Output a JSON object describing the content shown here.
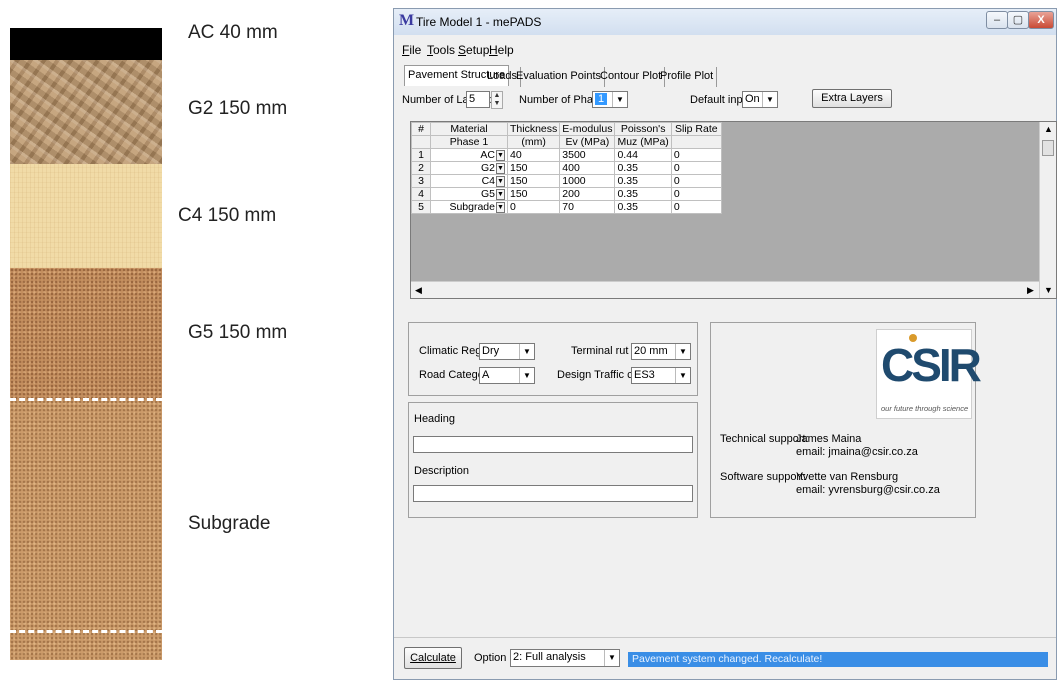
{
  "figure": {
    "layers": [
      {
        "label": "AC 40 mm"
      },
      {
        "label": "G2 150 mm"
      },
      {
        "label": "C4 150 mm"
      },
      {
        "label": "G5 150 mm"
      },
      {
        "label": "Subgrade"
      }
    ]
  },
  "window": {
    "app_icon": "M",
    "title": "Tire Model 1 - mePADS",
    "controls": {
      "minimize": "–",
      "maximize": "▢",
      "close": "X"
    }
  },
  "menu": [
    {
      "key": "F",
      "rest": "ile"
    },
    {
      "key": "T",
      "rest": "ools"
    },
    {
      "key": "S",
      "rest": "etup"
    },
    {
      "key": "H",
      "rest": "elp"
    }
  ],
  "tabs": [
    "Pavement Structure",
    "Loads",
    "Evaluation Points",
    "Contour Plot",
    "Profile Plot"
  ],
  "controls_row": {
    "layers_label": "Number of Layers:",
    "layers_value": "5",
    "phases_label": "Number of Phases:",
    "phases_value": "1",
    "default_label": "Default input:",
    "default_value": "On",
    "extra_layers_button": "Extra Layers"
  },
  "grid": {
    "headers_row1": [
      "#",
      "Material",
      "Thickness",
      "E-modulus",
      "Poisson's",
      "Slip Rate"
    ],
    "headers_row2": [
      "",
      "Phase 1",
      "(mm)",
      "Ev (MPa)",
      "Muz (MPa)",
      ""
    ],
    "rows": [
      {
        "n": "1",
        "material": "AC",
        "thickness": "40",
        "emod": "3500",
        "poisson": "0.44",
        "slip": "0"
      },
      {
        "n": "2",
        "material": "G2",
        "thickness": "150",
        "emod": "400",
        "poisson": "0.35",
        "slip": "0"
      },
      {
        "n": "3",
        "material": "C4",
        "thickness": "150",
        "emod": "1000",
        "poisson": "0.35",
        "slip": "0"
      },
      {
        "n": "4",
        "material": "G5",
        "thickness": "150",
        "emod": "200",
        "poisson": "0.35",
        "slip": "0"
      },
      {
        "n": "5",
        "material": "Subgrade",
        "thickness": "0",
        "emod": "70",
        "poisson": "0.35",
        "slip": "0"
      }
    ]
  },
  "settings": {
    "climatic_label": "Climatic Region",
    "climatic_value": "Dry",
    "road_label": "Road Category",
    "road_value": "A",
    "rut_label": "Terminal rut",
    "rut_value": "20 mm",
    "traffic_label": "Design Traffic class",
    "traffic_value": "ES3"
  },
  "info": {
    "heading_label": "Heading",
    "description_label": "Description"
  },
  "support": {
    "logo_text": "CSIR",
    "logo_tagline": "our future through science",
    "tech_label": "Technical support:",
    "tech_name": "James Maina",
    "tech_email": "email: jmaina@csir.co.za",
    "soft_label": "Software support:",
    "soft_name": "Yvette van Rensburg",
    "soft_email": "email: yvrensburg@csir.co.za"
  },
  "bottom": {
    "calculate_button": "Calculate",
    "option_label": "Option",
    "option_value": "2: Full analysis",
    "status": "Pavement system changed. Recalculate!"
  }
}
